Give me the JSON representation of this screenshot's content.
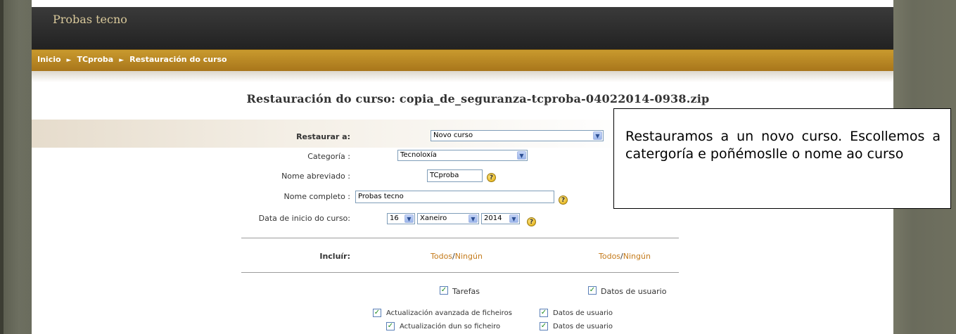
{
  "site": {
    "brand": "Probas tecno"
  },
  "breadcrumb": {
    "items": [
      "Inicio",
      "TCproba",
      "Restauración do curso"
    ],
    "separator": "►"
  },
  "page": {
    "title": "Restauración do curso: copia_de_seguranza-tcproba-04022014-0938.zip"
  },
  "form": {
    "restore_to": {
      "label": "Restaurar a:",
      "value": "Novo curso"
    },
    "category": {
      "label": "Categoría :",
      "value": "Tecnoloxía"
    },
    "short_name": {
      "label": "Nome abreviado :",
      "value": "TCproba"
    },
    "full_name": {
      "label": "Nome completo :",
      "value": "Probas tecno"
    },
    "start_date": {
      "label": "Data de inicio do curso:",
      "day": "16",
      "month": "Xaneiro",
      "year": "2014"
    },
    "include": {
      "label": "Incluír:",
      "all": "Todos",
      "slash": "/",
      "none": "Ningún",
      "all2": "Todos",
      "slash2": "/",
      "none2": "Ningún"
    },
    "modules": [
      {
        "name": "Tarefas",
        "user_data": "Datos de usuario"
      },
      {
        "name": "Actualización avanzada de ficheiros",
        "user_data": "Datos de usuario"
      },
      {
        "name": "Actualización dun so ficheiro",
        "user_data": "Datos de usuario"
      }
    ]
  },
  "callout": {
    "text": "Restauramos a un novo curso. Escollemos a catergoría e poñémoslle o nome ao curso"
  },
  "colors": {
    "header": "#2b2b2b",
    "breadcrumb_bar": "#b3831f",
    "link": "#c47a1a",
    "brand_text": "#d8c89a"
  },
  "icons": {
    "help": "help-icon",
    "dropdown": "chevron-down-icon",
    "checkbox": "checkbox-checked-icon"
  }
}
